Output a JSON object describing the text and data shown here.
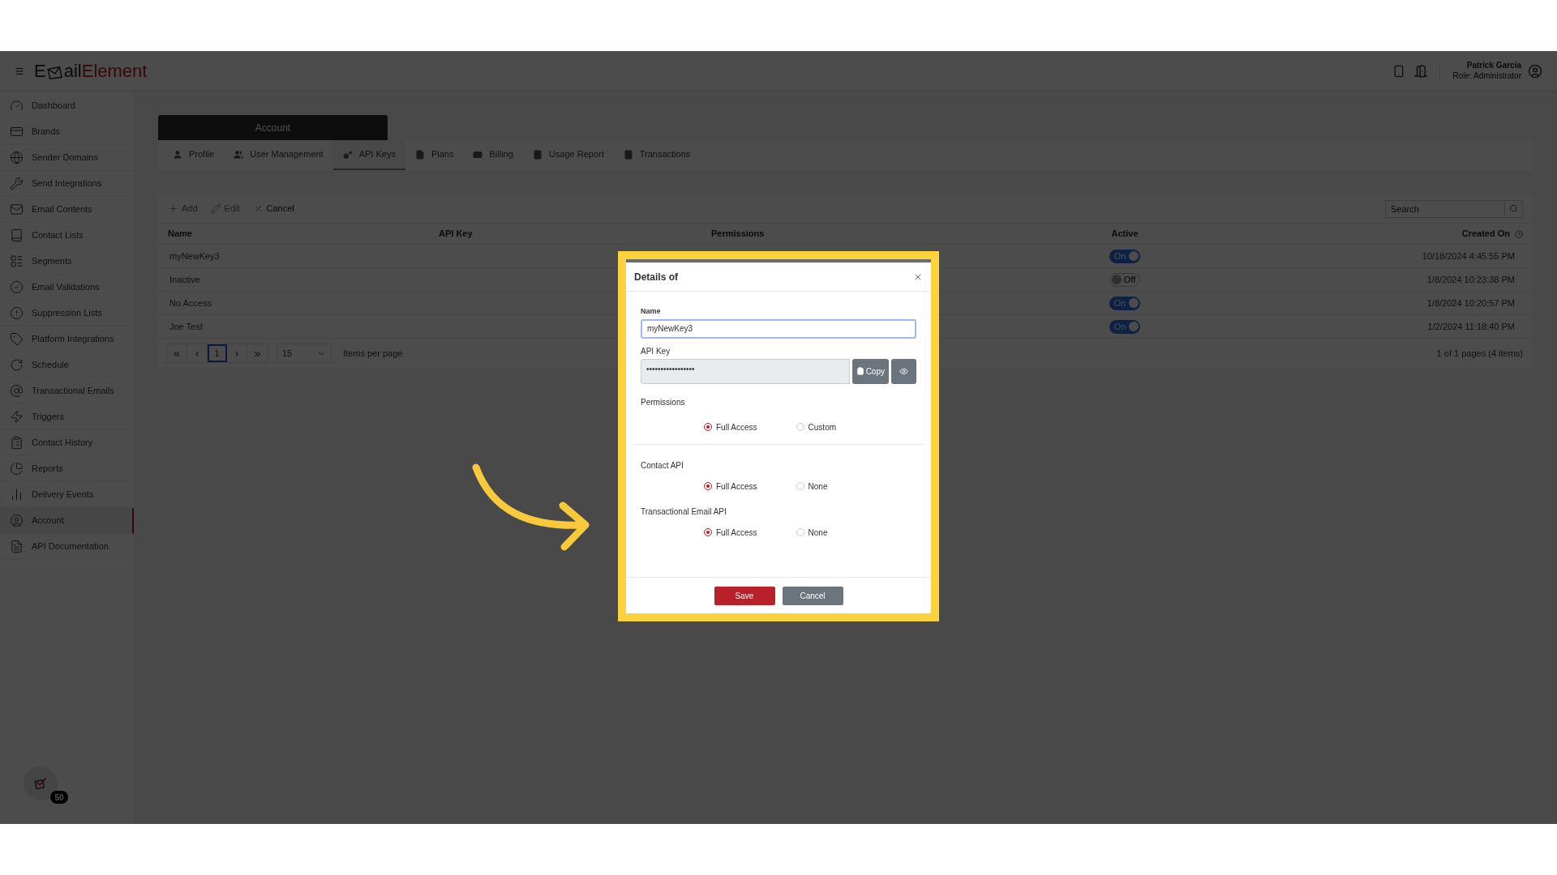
{
  "header": {
    "logo": {
      "first": "E",
      "rest": "ail",
      "brand": "Element"
    },
    "user": {
      "name": "Patrick Garcia",
      "role": "Role: Administrator"
    }
  },
  "sidebar": {
    "items": [
      {
        "label": "Dashboard",
        "selected": false
      },
      {
        "label": "Brands",
        "selected": false
      },
      {
        "label": "Sender Domains",
        "selected": false
      },
      {
        "label": "Send Integrations",
        "selected": false
      },
      {
        "label": "Email Contents",
        "selected": false
      },
      {
        "label": "Contact Lists",
        "selected": false
      },
      {
        "label": "Segments",
        "selected": false
      },
      {
        "label": "Email Validations",
        "selected": false
      },
      {
        "label": "Suppression Lists",
        "selected": false
      },
      {
        "label": "Platform Integrations",
        "selected": false
      },
      {
        "label": "Schedule",
        "selected": false
      },
      {
        "label": "Transactional Emails",
        "selected": false
      },
      {
        "label": "Triggers",
        "selected": false
      },
      {
        "label": "Contact History",
        "selected": false
      },
      {
        "label": "Reports",
        "selected": false
      },
      {
        "label": "Delivery Events",
        "selected": false
      },
      {
        "label": "Account",
        "selected": true
      },
      {
        "label": "API Documentation",
        "selected": false
      }
    ]
  },
  "page": {
    "title": "Account",
    "tabs": [
      {
        "label": "Profile",
        "selected": false
      },
      {
        "label": "User Management",
        "selected": false
      },
      {
        "label": "API Keys",
        "selected": true
      },
      {
        "label": "Plans",
        "selected": false
      },
      {
        "label": "Billing",
        "selected": false
      },
      {
        "label": "Usage Report",
        "selected": false
      },
      {
        "label": "Transactions",
        "selected": false
      }
    ]
  },
  "grid": {
    "toolbar": [
      {
        "label": "Add",
        "disabled": true
      },
      {
        "label": "Edit",
        "disabled": true
      },
      {
        "label": "Cancel",
        "disabled": false
      }
    ],
    "search": {
      "placeholder": "Search"
    },
    "columns": [
      "Name",
      "API Key",
      "Permissions",
      "Active",
      "Created On"
    ],
    "rows": [
      {
        "name": "myNewKey3",
        "active": {
          "on": true,
          "label": "On"
        },
        "created_on": "10/18/2024 4:45:55 PM"
      },
      {
        "name": "Inactive",
        "active": {
          "on": false,
          "label": "Off"
        },
        "created_on": "1/8/2024 10:23:38 PM"
      },
      {
        "name": "No Access",
        "active": {
          "on": true,
          "label": "On"
        },
        "created_on": "1/8/2024 10:20:57 PM"
      },
      {
        "name": "Joe Test",
        "active": {
          "on": true,
          "label": "On"
        },
        "created_on": "1/2/2024 11:18:40 PM"
      }
    ],
    "pager": {
      "first": "«",
      "prev": "‹",
      "pages": [
        {
          "label": "1",
          "selected": true
        }
      ],
      "next": "›",
      "last": "»",
      "page_size": "15",
      "page_size_label": "Items per page",
      "summary": "1 of 1 pages (4 items)"
    }
  },
  "modal": {
    "title": "Details of",
    "name_field": {
      "label": "Name",
      "value": "myNewKey3"
    },
    "api_key_field": {
      "label": "API Key",
      "value": "•••••••••••••••••"
    },
    "copy_button": "Copy",
    "groups": [
      {
        "label": "Permissions",
        "options": [
          {
            "label": "Full Access",
            "selected": true
          },
          {
            "label": "Custom",
            "selected": false
          }
        ]
      },
      {
        "label": "Contact API",
        "options": [
          {
            "label": "Full Access",
            "selected": true
          },
          {
            "label": "None",
            "selected": false
          }
        ]
      },
      {
        "label": "Transactional Email API",
        "options": [
          {
            "label": "Full Access",
            "selected": true
          },
          {
            "label": "None",
            "selected": false
          }
        ]
      }
    ],
    "save_button": "Save",
    "cancel_button": "Cancel"
  },
  "notification_badge": {
    "count": "50"
  }
}
